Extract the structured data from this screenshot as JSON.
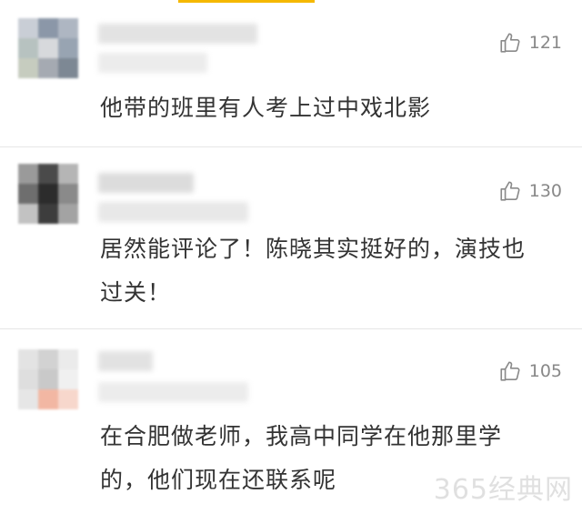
{
  "comments": [
    {
      "text": "他带的班里有人考上过中戏北影",
      "likes": "121"
    },
    {
      "text": "居然能评论了！陈晓其实挺好的，演技也过关！",
      "likes": "130"
    },
    {
      "text": "在合肥做老师，我高中同学在他那里学的，他们现在还联系呢",
      "likes": "105"
    }
  ],
  "watermark": "365经典网",
  "icons": {
    "like": "thumbs-up-icon"
  },
  "colors": {
    "text": "#333333",
    "muted": "#888888",
    "divider": "#e6e6e6"
  }
}
